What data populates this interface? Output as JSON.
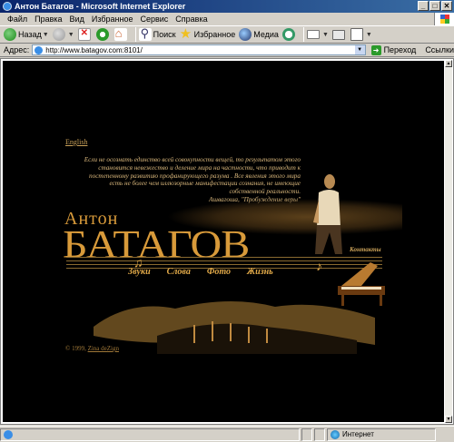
{
  "window": {
    "title": "Антон Батагов - Microsoft Internet Explorer",
    "min": "_",
    "max": "□",
    "close": "✕"
  },
  "menu": [
    "Файл",
    "Правка",
    "Вид",
    "Избранное",
    "Сервис",
    "Справка"
  ],
  "toolbar": {
    "back": "Назад",
    "search": "Поиск",
    "favorites": "Избранное",
    "media": "Медиа"
  },
  "address": {
    "label": "Адрес:",
    "url": "http://www.batagov.com:8101/",
    "go": "Переход",
    "links": "Ссылки"
  },
  "page": {
    "english_link": "English",
    "quote_lines": [
      "Если не осознать единство всей совокупности вещей, то результатом этого",
      "становится невежество и деление мира на частности, что приводит к",
      "постепенному развитию профанирующего разума . Все явления этого мира",
      "есть не более чем иллюзорные манифестации сознания, не имеющие",
      "собственной реальности."
    ],
    "quote_attribution": "Ашвагоша, \"Пробуждение веры\"",
    "name_first": "Антон",
    "name_last": "БАТАГОВ",
    "contacts": "Контакты",
    "nav": [
      "Звуки",
      "Слова",
      "Фото",
      "Жизнь"
    ],
    "copyright_prefix": "© 1999,",
    "copyright_link": "Zina deZign"
  },
  "status": {
    "zone": "Интернет"
  },
  "colors": {
    "accent_gold": "#d89a3a",
    "quote_text": "#d9b77c",
    "page_bg": "#000000",
    "titlebar": "#0a246a"
  }
}
